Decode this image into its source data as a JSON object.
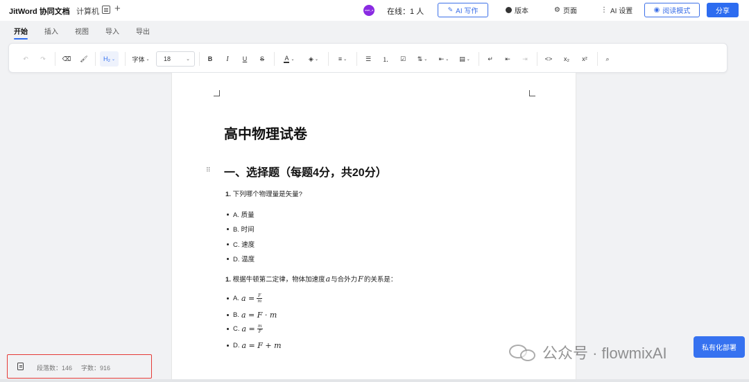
{
  "app": {
    "title": "JitWord 协同文档",
    "doc_name": "计算机",
    "plus": "+"
  },
  "header": {
    "avatar_text": "user_a",
    "online": "在线：1 人",
    "ai_write": "AI 写作",
    "version": "版本",
    "page": "页面",
    "ai_settings": "AI 设置",
    "read_mode": "阅读模式",
    "share": "分享"
  },
  "tabs": [
    "开始",
    "插入",
    "视图",
    "导入",
    "导出"
  ],
  "toolbar": {
    "undo": "↶",
    "redo": "↷",
    "eraser": "⌫",
    "format_painter": "🖌",
    "heading": "H₂",
    "font": "字体",
    "font_size": "18",
    "bold": "B",
    "italic": "I",
    "underline": "U",
    "strike": "S",
    "font_color": "A",
    "highlight": "◈",
    "align": "≡",
    "bullet_list": "☰",
    "ordered_list": "⒈",
    "task_list": "☑",
    "line_height": "⇅",
    "indent": "⇤",
    "paragraph": "▤",
    "wrap": "↵",
    "outdent": "⇤",
    "indent2": "⇥",
    "code": "<>",
    "subscript": "x₂",
    "superscript": "x²",
    "search": "⌕"
  },
  "document": {
    "title": "高中物理试卷",
    "section": "一、选择题（每题4分，共20分）",
    "q1": {
      "num": "1.",
      "text": "下列哪个物理量是矢量?"
    },
    "q1_options": [
      "A. 质量",
      "B. 时间",
      "C. 速度",
      "D. 温度"
    ],
    "q2": {
      "num": "1.",
      "text_a": "根据牛顿第二定律，物体加速度",
      "var_a": "a",
      "text_b": "与合外力",
      "var_f": "F",
      "text_c": "的关系是："
    },
    "q2_options": [
      {
        "label": "A.",
        "lhs": "a =",
        "num": "F",
        "den": "m"
      },
      {
        "label": "B.",
        "expr": "a = F · m"
      },
      {
        "label": "C.",
        "lhs": "a =",
        "num": "m",
        "den": "F"
      },
      {
        "label": "D.",
        "expr": "a = F + m"
      }
    ]
  },
  "status": {
    "paragraphs": "段落数：146",
    "words": "字数：916"
  },
  "watermark": "公众号 · flowmixAI",
  "deploy": "私有化部署"
}
